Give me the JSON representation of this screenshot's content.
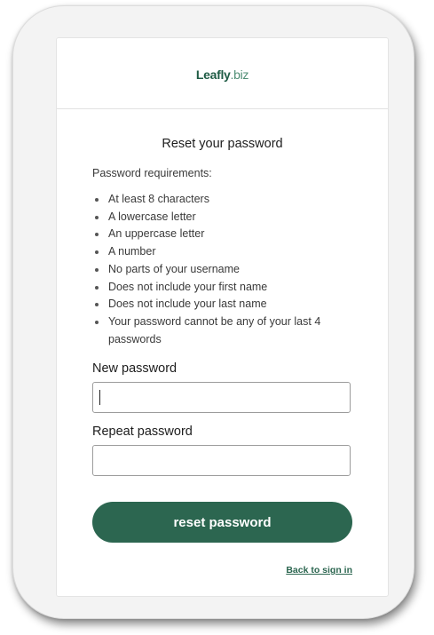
{
  "brand": {
    "name": "Leafly",
    "suffix": ".biz",
    "color": "#1f5c45"
  },
  "form": {
    "title": "Reset your password",
    "requirements_heading": "Password requirements:",
    "requirements": [
      "At least 8 characters",
      "A lowercase letter",
      "An uppercase letter",
      "A number",
      "No parts of your username",
      "Does not include your first name",
      "Does not include your last name",
      "Your password cannot be any of your last 4 passwords"
    ],
    "new_password_label": "New password",
    "new_password_value": "",
    "repeat_password_label": "Repeat password",
    "repeat_password_value": "",
    "submit_label": "reset password",
    "back_link": "Back to sign in"
  },
  "colors": {
    "accent": "#2c6650",
    "text": "#1d1d1d"
  }
}
